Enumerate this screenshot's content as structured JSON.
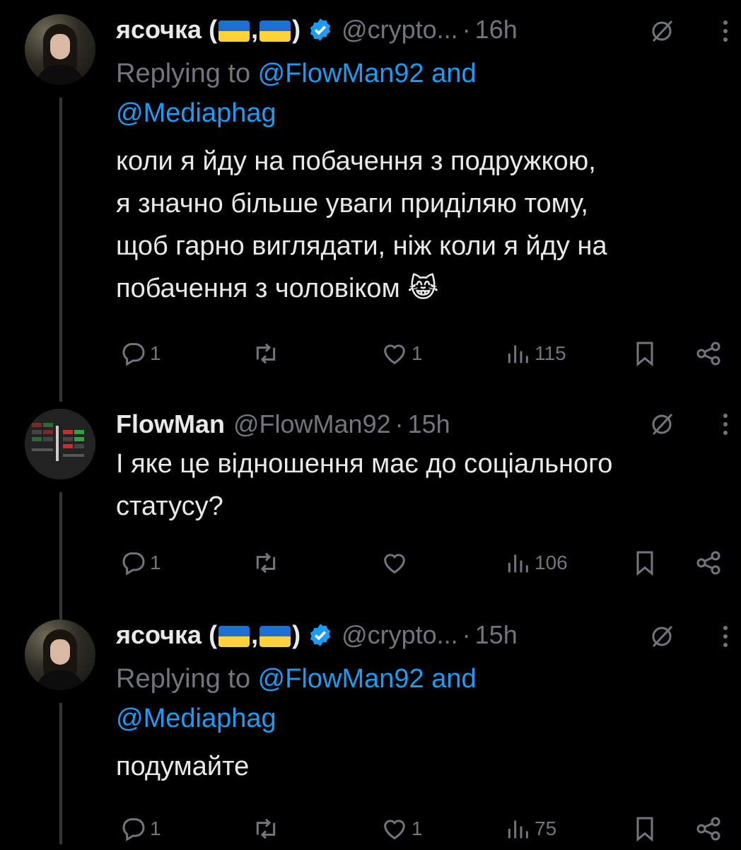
{
  "tweets": [
    {
      "name": "ясочка (",
      "name_sep": ",",
      "name_close": ")",
      "handle": "@crypto...",
      "dot": "·",
      "time": "16h",
      "reply_prefix": "Replying to ",
      "reply_user1": "@FlowMan92",
      "reply_and": " and",
      "reply_user2": "@Mediaphag",
      "text_lines": [
        "коли я йду на побачення з подружкою,",
        "я значно більше уваги приділяю тому,",
        "щоб гарно виглядати, ніж коли я йду на",
        "побачення з чоловіком"
      ],
      "emoji": "😹",
      "replies": "1",
      "reposts": "",
      "likes": "1",
      "views": "115"
    },
    {
      "name": "FlowMan",
      "handle": "@FlowMan92",
      "dot": "·",
      "time": "15h",
      "text_lines": [
        "І яке це відношення має до соціального",
        "статусу?"
      ],
      "replies": "1",
      "reposts": "",
      "likes": "",
      "views": "106"
    },
    {
      "name": "ясочка (",
      "name_sep": ",",
      "name_close": ")",
      "handle": "@crypto...",
      "dot": "·",
      "time": "15h",
      "reply_prefix": "Replying to ",
      "reply_user1": "@FlowMan92",
      "reply_and": " and",
      "reply_user2": "@Mediaphag",
      "text_lines": [
        "подумайте"
      ],
      "replies": "1",
      "reposts": "",
      "likes": "1",
      "views": "75"
    }
  ],
  "colors": {
    "background": "#000000",
    "text": "#e7e9ea",
    "muted": "#71767b",
    "link": "#1d9bf0",
    "verified": "#1d9bf0",
    "flag_blue": "#1d6fd6",
    "flag_yellow": "#ffd43a"
  },
  "icons": [
    "reply-icon",
    "repost-icon",
    "like-icon",
    "views-icon",
    "bookmark-icon",
    "share-icon",
    "grok-icon",
    "more-icon",
    "verified-badge-icon"
  ]
}
